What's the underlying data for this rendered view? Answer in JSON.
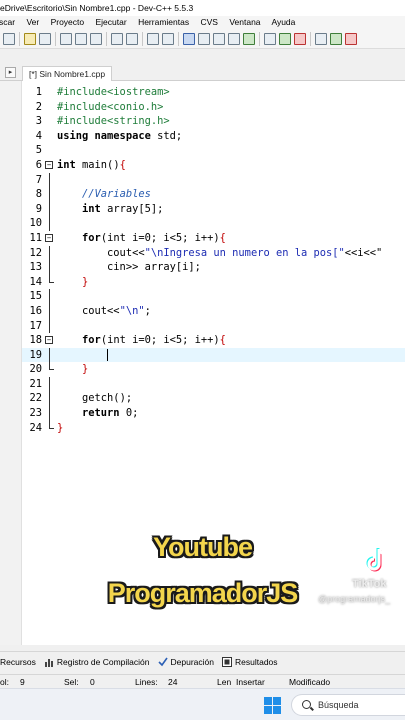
{
  "window": {
    "title": "eDrive\\Escritorio\\Sin Nombre1.cpp - Dev-C++ 5.5.3"
  },
  "menu": [
    "scar",
    "Ver",
    "Proyecto",
    "Ejecutar",
    "Herramientas",
    "CVS",
    "Ventana",
    "Ayuda"
  ],
  "tab": {
    "label": "[*] Sin Nombre1.cpp",
    "arrow": "▸"
  },
  "editor": {
    "line_numbers": [
      "1",
      "2",
      "3",
      "4",
      "5",
      "6",
      "7",
      "8",
      "9",
      "10",
      "11",
      "12",
      "13",
      "14",
      "15",
      "16",
      "17",
      "18",
      "19",
      "20",
      "21",
      "22",
      "23",
      "24"
    ],
    "active_line": 19,
    "code": {
      "l1": "#include<iostream>",
      "l2": "#include<conio.h>",
      "l3": "#include<string.h>",
      "l4_kw": "using namespace",
      "l4_rest": " std;",
      "l6_kw": "int",
      "l6_rest": " main()",
      "l6_brace": "{",
      "l8": "//Variables",
      "l9_kw": "int",
      "l9_rest": " array[5];",
      "l11_kw": "for",
      "l11_a": "(int i=0; i<5; i++)",
      "l11_b": "{",
      "l12_a": "cout<<",
      "l12_str": "\"\\nIngresa un numero en la pos[\"",
      "l12_b": "<<i<<\"",
      "l13": "cin>> array[i];",
      "l14": "}",
      "l16_a": "cout<<",
      "l16_str": "\"\\n\"",
      "l16_b": ";",
      "l18_kw": "for",
      "l18_a": "(int i=0; i<5; i++)",
      "l18_b": "{",
      "l20": "}",
      "l22": "getch();",
      "l23_kw": "return",
      "l23_rest": " 0;",
      "l24": "}"
    }
  },
  "overlay": {
    "line1": "Youtube",
    "line2": "ProgramadorJS",
    "tiktok_brand": "TikTok",
    "tiktok_handle": "@programadorjs_"
  },
  "bottom_tabs": {
    "recursos": "Recursos",
    "registro": "Registro de Compilación",
    "depuracion": "Depuración",
    "resultados": "Resultados"
  },
  "status": {
    "col_label": "ol:",
    "col_value": "9",
    "sel_label": "Sel:",
    "sel_value": "0",
    "lines_label": "Lines:",
    "lines_value": "24",
    "len_label": "Len",
    "mode": "Insertar",
    "state": "Modificado"
  },
  "taskbar": {
    "search_placeholder": "Búsqueda"
  },
  "colors": {
    "accent": "#1f8ee8",
    "overlay_yellow": "#f3d54c",
    "active_line": "#e5f6ff"
  }
}
